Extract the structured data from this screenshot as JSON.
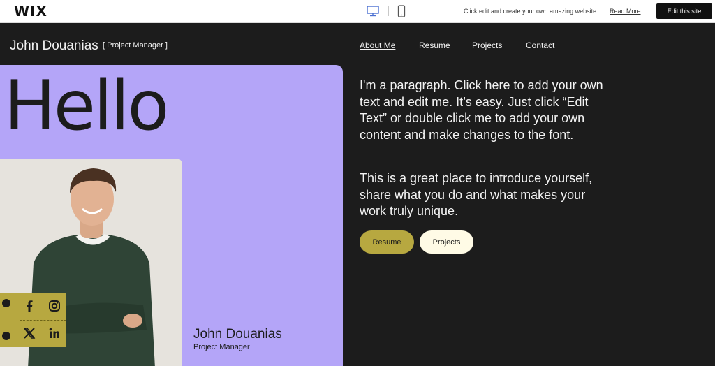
{
  "wix_bar": {
    "logo": "WIX",
    "message": "Click edit and create your own amazing website",
    "read_more": "Read More",
    "edit_button": "Edit this site",
    "devices": [
      "desktop-icon",
      "mobile-icon"
    ]
  },
  "header": {
    "name": "John Douanias",
    "role": "[ Project Manager ]"
  },
  "nav": {
    "items": [
      "About Me",
      "Resume",
      "Projects",
      "Contact"
    ],
    "active": "About Me"
  },
  "hero": {
    "greeting": "Hello",
    "card_name": "John Douanias",
    "card_role": "Project Manager"
  },
  "social": {
    "icons": [
      "facebook-icon",
      "instagram-icon",
      "x-icon",
      "linkedin-icon"
    ]
  },
  "content": {
    "paragraph1": "I'm a paragraph. Click here to add your own text and edit me. It’s easy. Just click “Edit Text” or double click me to add your own content and make changes to the font.",
    "paragraph2": "This is a great place to introduce yourself, share what you do and what makes your work truly unique.",
    "resume_button": "Resume",
    "projects_button": "Projects"
  },
  "colors": {
    "background": "#1c1c1c",
    "hero": "#b4a5f8",
    "accent": "#b7a840",
    "light_button": "#fffbe6"
  }
}
